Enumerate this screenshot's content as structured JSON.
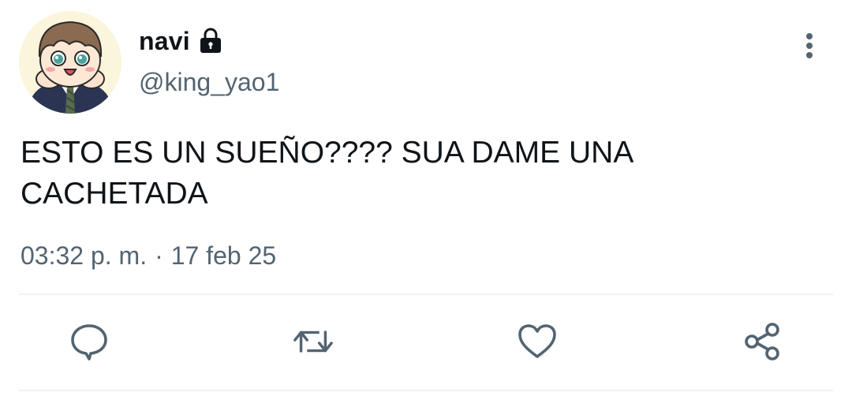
{
  "author": {
    "display_name": "navi",
    "handle": "@king_yao1",
    "protected_icon": "lock-icon",
    "avatar": "cartoon-boy-avatar"
  },
  "tweet": {
    "text": "ESTO ES UN SUEÑO???? SUA DAME UNA\nCACHETADA",
    "time": "03:32 p. m.",
    "separator": "·",
    "date": "17 feb 25"
  },
  "actions": [
    {
      "name": "reply",
      "icon": "speech-bubble-icon"
    },
    {
      "name": "retweet",
      "icon": "retweet-arrows-icon"
    },
    {
      "name": "like",
      "icon": "heart-icon"
    },
    {
      "name": "share",
      "icon": "share-nodes-icon"
    }
  ],
  "colors": {
    "text_primary": "#0f1419",
    "text_secondary": "#536471",
    "icon_gray": "#536471",
    "divider": "#eff3f4"
  }
}
